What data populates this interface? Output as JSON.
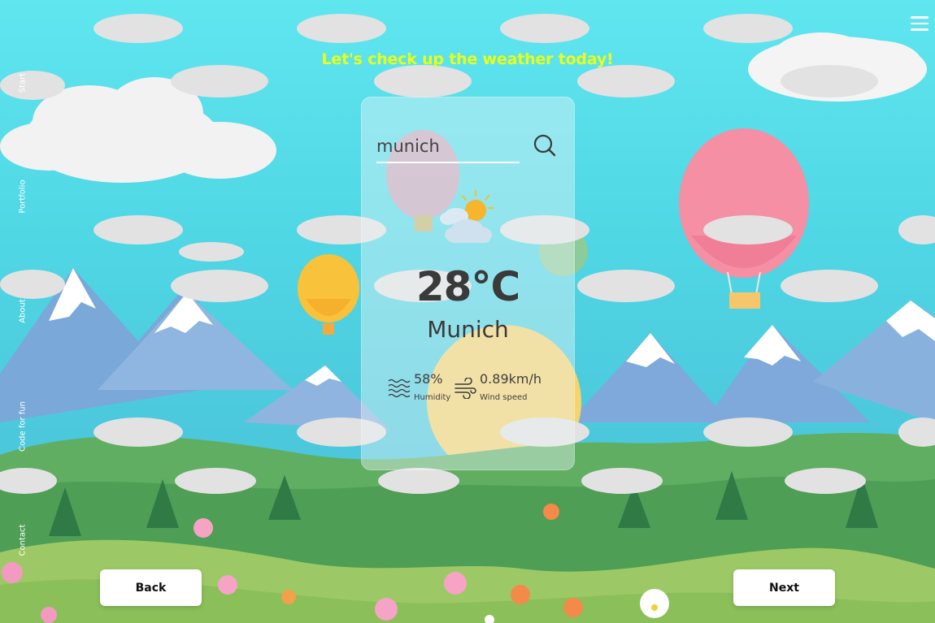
{
  "header": {
    "headline": "Let's check up the weather today!",
    "headline_color": "#e8ff19"
  },
  "menu": {
    "icon": "hamburger-menu-icon"
  },
  "sidenav": {
    "items": [
      {
        "label": "Start"
      },
      {
        "label": "Portfolio"
      },
      {
        "label": "About"
      },
      {
        "label": "Code for fun"
      },
      {
        "label": "Contact"
      }
    ]
  },
  "search": {
    "value": "munich",
    "icon": "search-icon"
  },
  "weather": {
    "icon": "partly-cloudy-icon",
    "temperature": "28°C",
    "city": "Munich",
    "humidity": {
      "value": "58%",
      "label": "Humidity",
      "icon": "humidity-waves-icon"
    },
    "wind": {
      "value": "0.89km/h",
      "label": "Wind speed",
      "icon": "wind-icon"
    }
  },
  "footer": {
    "back_label": "Back",
    "next_label": "Next"
  }
}
